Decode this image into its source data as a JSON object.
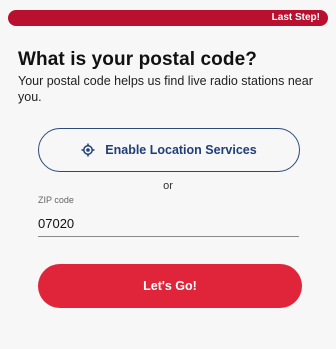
{
  "progress": {
    "label": "Last Step!",
    "fraction": 1.0,
    "color": "#b8102e"
  },
  "header": {
    "title": "What is your postal code?",
    "subtitle": "Your postal code helps us find live radio stations near you."
  },
  "location_button": {
    "label": "Enable Location Services",
    "icon": "location-target-icon",
    "color": "#1f3f76"
  },
  "separator": {
    "text": "or"
  },
  "zip_field": {
    "label": "ZIP code",
    "value": "07020"
  },
  "submit_button": {
    "label": "Let's Go!",
    "color": "#e0253a"
  }
}
